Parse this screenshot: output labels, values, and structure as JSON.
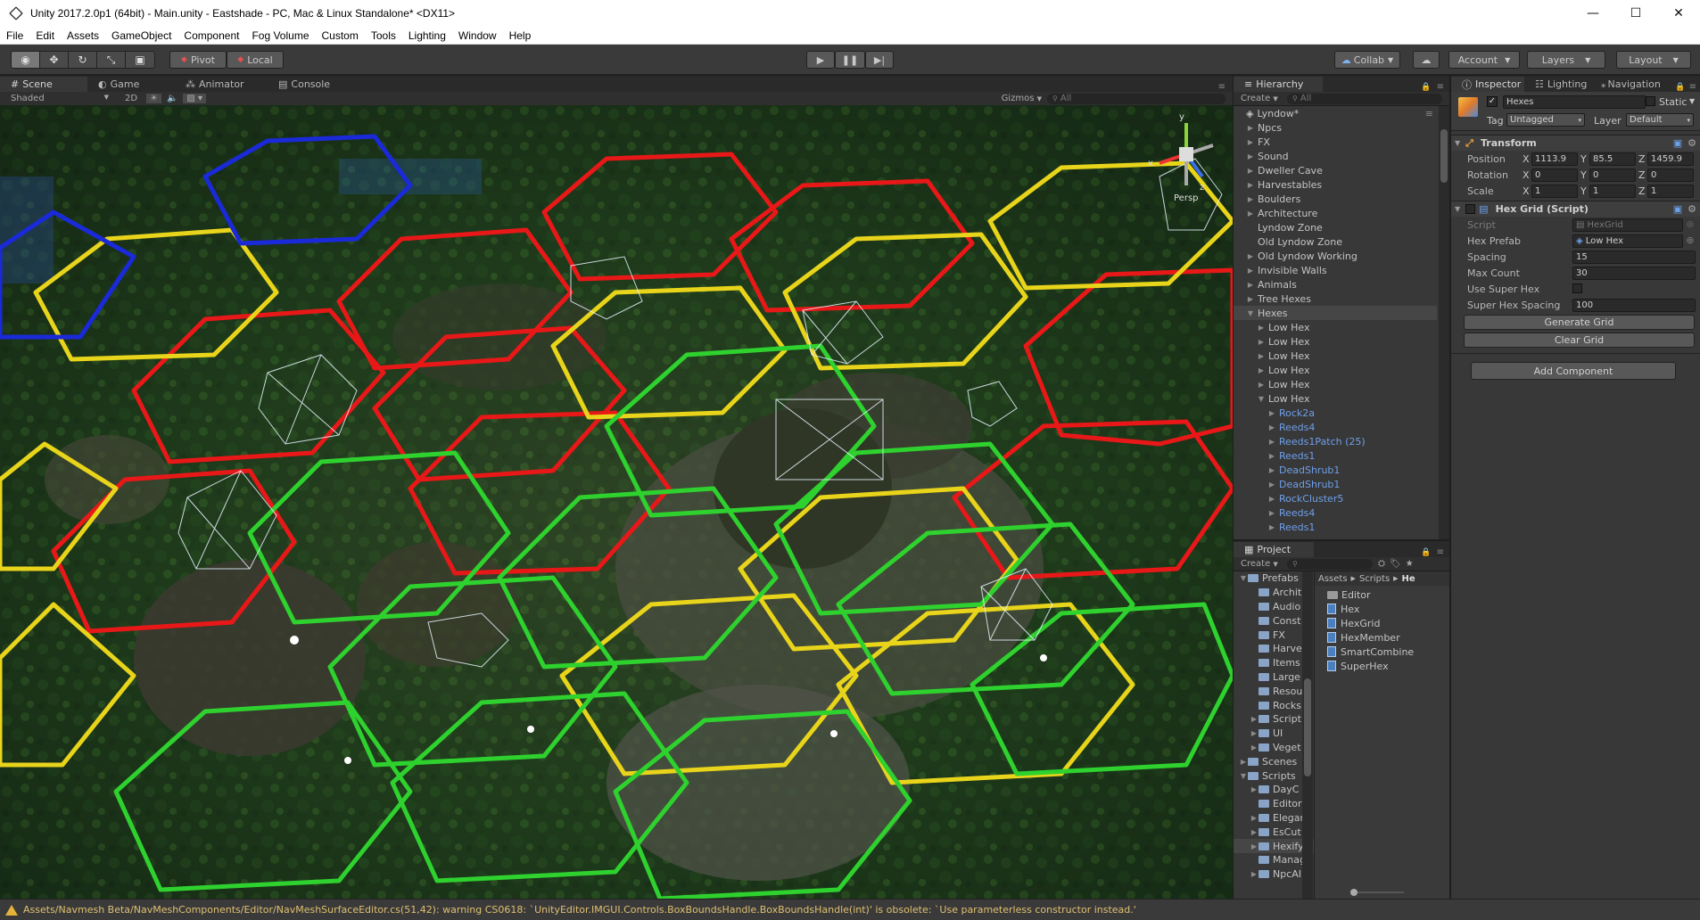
{
  "window": {
    "title": "Unity 2017.2.0p1 (64bit) - Main.unity - Eastshade - PC, Mac & Linux Standalone* <DX11>",
    "minimize": "—",
    "maximize": "☐",
    "close": "✕"
  },
  "menu": [
    "File",
    "Edit",
    "Assets",
    "GameObject",
    "Component",
    "Fog Volume",
    "Custom",
    "Tools",
    "Lighting",
    "Window",
    "Help"
  ],
  "toolbar": {
    "pivot_label": "Pivot",
    "local_label": "Local",
    "collab_label": "Collab",
    "account_label": "Account",
    "layers_label": "Layers",
    "layout_label": "Layout"
  },
  "scene_panel": {
    "tabs": [
      "Scene",
      "Game",
      "Animator",
      "Console"
    ],
    "shading_mode": "Shaded",
    "mode_2d": "2D",
    "gizmos_label": "Gizmos",
    "search_placeholder": "All",
    "gizmo_axis_x": "x",
    "gizmo_axis_y": "y",
    "gizmo_axis_z": "z",
    "gizmo_persp": "Persp"
  },
  "hierarchy": {
    "tab": "Hierarchy",
    "create_label": "Create",
    "search_placeholder": "All",
    "scene_root": "Lyndow*",
    "items": [
      {
        "label": "Npcs",
        "depth": 0,
        "arrow": "▶",
        "blue": false
      },
      {
        "label": "FX",
        "depth": 0,
        "arrow": "▶",
        "blue": false
      },
      {
        "label": "Sound",
        "depth": 0,
        "arrow": "▶",
        "blue": false
      },
      {
        "label": "Dweller Cave",
        "depth": 0,
        "arrow": "▶",
        "blue": false
      },
      {
        "label": "Harvestables",
        "depth": 0,
        "arrow": "▶",
        "blue": false
      },
      {
        "label": "Boulders",
        "depth": 0,
        "arrow": "▶",
        "blue": false
      },
      {
        "label": "Architecture",
        "depth": 0,
        "arrow": "▶",
        "blue": false
      },
      {
        "label": "Lyndow Zone",
        "depth": 0,
        "arrow": "",
        "blue": false
      },
      {
        "label": "Old Lyndow Zone",
        "depth": 0,
        "arrow": "",
        "blue": false
      },
      {
        "label": "Old Lyndow Working",
        "depth": 0,
        "arrow": "▶",
        "blue": false
      },
      {
        "label": "Invisible Walls",
        "depth": 0,
        "arrow": "▶",
        "blue": false
      },
      {
        "label": "Animals",
        "depth": 0,
        "arrow": "▶",
        "blue": false
      },
      {
        "label": "Tree Hexes",
        "depth": 0,
        "arrow": "▶",
        "blue": false
      },
      {
        "label": "Hexes",
        "depth": 0,
        "arrow": "▼",
        "blue": false,
        "selected": true
      },
      {
        "label": "Low Hex",
        "depth": 1,
        "arrow": "▶",
        "blue": false
      },
      {
        "label": "Low Hex",
        "depth": 1,
        "arrow": "▶",
        "blue": false
      },
      {
        "label": "Low Hex",
        "depth": 1,
        "arrow": "▶",
        "blue": false
      },
      {
        "label": "Low Hex",
        "depth": 1,
        "arrow": "▶",
        "blue": false
      },
      {
        "label": "Low Hex",
        "depth": 1,
        "arrow": "▶",
        "blue": false
      },
      {
        "label": "Low Hex",
        "depth": 1,
        "arrow": "▼",
        "blue": false
      },
      {
        "label": "Rock2a",
        "depth": 2,
        "arrow": "▶",
        "blue": true
      },
      {
        "label": "Reeds4",
        "depth": 2,
        "arrow": "▶",
        "blue": true
      },
      {
        "label": "Reeds1Patch (25)",
        "depth": 2,
        "arrow": "▶",
        "blue": true
      },
      {
        "label": "Reeds1",
        "depth": 2,
        "arrow": "▶",
        "blue": true
      },
      {
        "label": "DeadShrub1",
        "depth": 2,
        "arrow": "▶",
        "blue": true
      },
      {
        "label": "DeadShrub1",
        "depth": 2,
        "arrow": "▶",
        "blue": true
      },
      {
        "label": "RockCluster5",
        "depth": 2,
        "arrow": "▶",
        "blue": true
      },
      {
        "label": "Reeds4",
        "depth": 2,
        "arrow": "▶",
        "blue": true
      },
      {
        "label": "Reeds1",
        "depth": 2,
        "arrow": "▶",
        "blue": true
      }
    ]
  },
  "project": {
    "tab": "Project",
    "create_label": "Create",
    "breadcrumb": [
      "Assets",
      "Scripts",
      "He"
    ],
    "folders": [
      {
        "label": "Prefabs",
        "depth": 0,
        "arrow": "▼"
      },
      {
        "label": "Archit",
        "depth": 1,
        "arrow": ""
      },
      {
        "label": "Audio",
        "depth": 1,
        "arrow": ""
      },
      {
        "label": "Const",
        "depth": 1,
        "arrow": ""
      },
      {
        "label": "FX",
        "depth": 1,
        "arrow": ""
      },
      {
        "label": "Harve",
        "depth": 1,
        "arrow": ""
      },
      {
        "label": "Items",
        "depth": 1,
        "arrow": ""
      },
      {
        "label": "Large",
        "depth": 1,
        "arrow": ""
      },
      {
        "label": "Resou",
        "depth": 1,
        "arrow": ""
      },
      {
        "label": "Rocks",
        "depth": 1,
        "arrow": ""
      },
      {
        "label": "Script",
        "depth": 1,
        "arrow": "▶"
      },
      {
        "label": "UI",
        "depth": 1,
        "arrow": "▶"
      },
      {
        "label": "Veget",
        "depth": 1,
        "arrow": "▶"
      },
      {
        "label": "Scenes",
        "depth": 0,
        "arrow": "▶"
      },
      {
        "label": "Scripts",
        "depth": 0,
        "arrow": "▼"
      },
      {
        "label": "DayC",
        "depth": 1,
        "arrow": "▶"
      },
      {
        "label": "Editor",
        "depth": 1,
        "arrow": ""
      },
      {
        "label": "Elegar",
        "depth": 1,
        "arrow": "▶"
      },
      {
        "label": "EsCut",
        "depth": 1,
        "arrow": "▶"
      },
      {
        "label": "Hexify",
        "depth": 1,
        "arrow": "▶",
        "selected": true
      },
      {
        "label": "Manag",
        "depth": 1,
        "arrow": ""
      },
      {
        "label": "NpcAI",
        "depth": 1,
        "arrow": "▶"
      }
    ],
    "files": [
      {
        "label": "Editor",
        "type": "folder"
      },
      {
        "label": "Hex",
        "type": "script"
      },
      {
        "label": "HexGrid",
        "type": "script"
      },
      {
        "label": "HexMember",
        "type": "script"
      },
      {
        "label": "SmartCombine",
        "type": "script"
      },
      {
        "label": "SuperHex",
        "type": "script"
      }
    ]
  },
  "inspector": {
    "tabs": [
      "Inspector",
      "Lighting",
      "Navigation"
    ],
    "object_name": "Hexes",
    "static_label": "Static",
    "tag_label": "Tag",
    "tag_value": "Untagged",
    "layer_label": "Layer",
    "layer_value": "Default",
    "transform": {
      "title": "Transform",
      "position_label": "Position",
      "rotation_label": "Rotation",
      "scale_label": "Scale",
      "position": {
        "x": "1113.9",
        "y": "85.5",
        "z": "1459.9"
      },
      "rotation": {
        "x": "0",
        "y": "0",
        "z": "0"
      },
      "scale": {
        "x": "1",
        "y": "1",
        "z": "1"
      }
    },
    "hexgrid": {
      "title": "Hex Grid (Script)",
      "script_label": "Script",
      "script_value": "HexGrid",
      "hex_prefab_label": "Hex Prefab",
      "hex_prefab_value": "Low Hex",
      "spacing_label": "Spacing",
      "spacing_value": "15",
      "max_count_label": "Max Count",
      "max_count_value": "30",
      "use_super_hex_label": "Use Super Hex",
      "super_hex_spacing_label": "Super Hex Spacing",
      "super_hex_spacing_value": "100",
      "generate_button": "Generate Grid",
      "clear_button": "Clear Grid"
    },
    "add_component": "Add Component"
  },
  "status": {
    "message": "Assets/Navmesh Beta/NavMeshComponents/Editor/NavMeshSurfaceEditor.cs(51,42): warning CS0618: `UnityEditor.IMGUI.Controls.BoxBoundsHandle.BoxBoundsHandle(int)' is obsolete: `Use parameterless constructor instead.'"
  },
  "colors": {
    "hex_red": "#e81818",
    "hex_yellow": "#e8d41a",
    "hex_green": "#2ed12e",
    "hex_blue": "#1a2ad8",
    "wire_white": "#e8f4ff"
  }
}
